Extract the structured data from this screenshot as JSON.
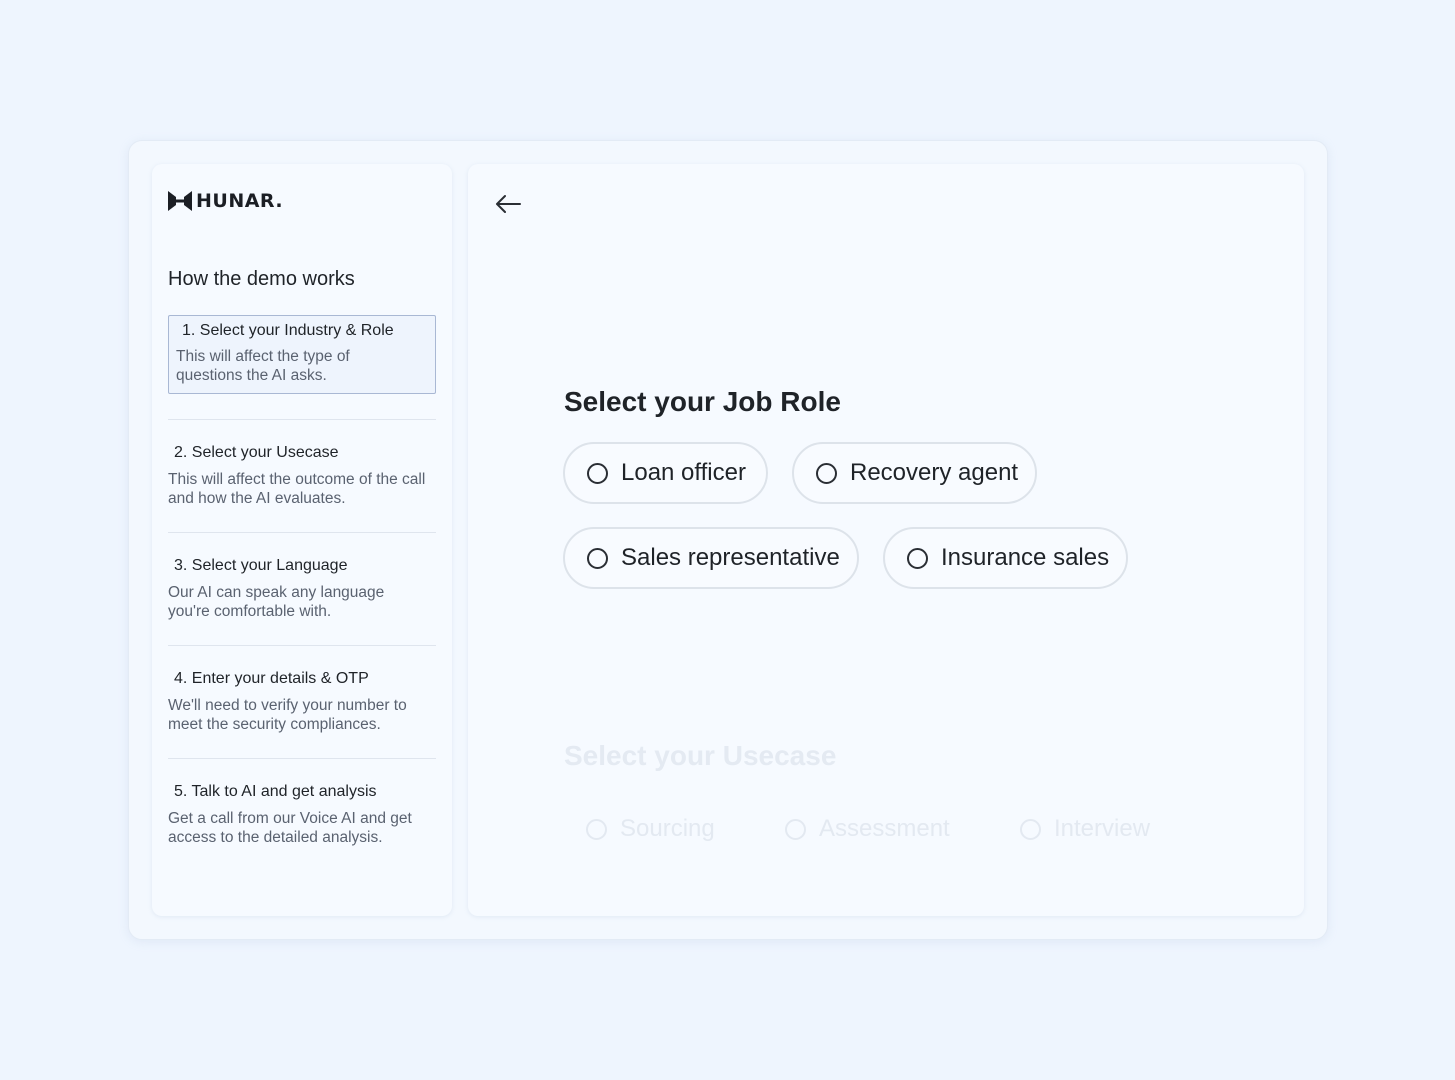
{
  "brand": {
    "logo_text": "HUNAR."
  },
  "sidebar": {
    "title": "How the demo works",
    "steps": [
      {
        "title": "1. Select your Industry & Role",
        "desc": "This will affect the type of questions the AI asks.",
        "active": true
      },
      {
        "title": "2. Select your Usecase",
        "desc": "This will affect the outcome of the call and how the AI evaluates."
      },
      {
        "title": "3. Select your Language",
        "desc": "Our AI can speak any language you're comfortable with."
      },
      {
        "title": "4. Enter your details & OTP",
        "desc": "We'll need to verify your number to meet the security compliances."
      },
      {
        "title": "5. Talk to AI and get analysis",
        "desc": "Get a call from our Voice AI and get access to the detailed analysis."
      }
    ]
  },
  "main": {
    "back_icon": "arrow-left-icon",
    "job_role": {
      "title": "Select your Job Role",
      "options": [
        "Loan officer",
        "Recovery agent",
        "Sales representative",
        "Insurance sales"
      ]
    },
    "usecase": {
      "title": "Select your Usecase",
      "options": [
        "Sourcing",
        "Assessment",
        "Interview"
      ]
    }
  },
  "colors": {
    "page_bg": "#eef5fe",
    "panel_bg": "#f6faff",
    "active_step_border": "#a9b8d4",
    "faded_text": "#e4eaf2"
  }
}
